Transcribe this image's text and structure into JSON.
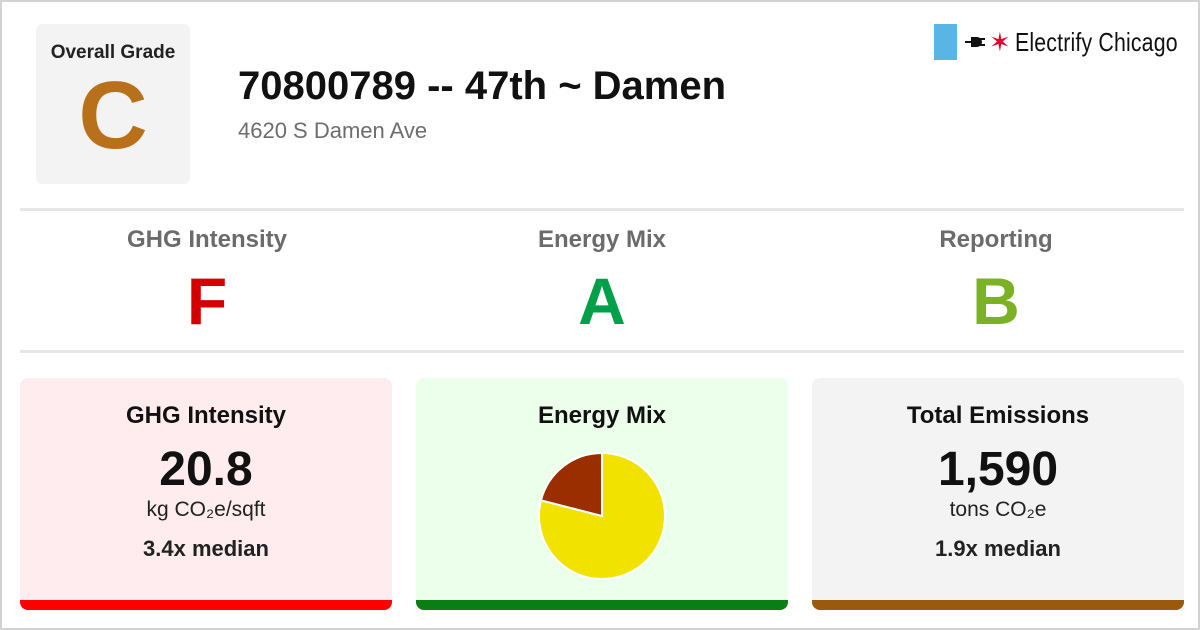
{
  "overall": {
    "label": "Overall Grade",
    "grade": "C",
    "color": "#b8711a"
  },
  "building": {
    "title": "70800789 -- 47th ~ Damen",
    "address": "4620 S Damen Ave"
  },
  "brand": {
    "name": "Electrify Chicago",
    "flag_color": "#58b5e4",
    "star_color": "#e4002b",
    "icons": [
      "plug-icon",
      "star-icon"
    ]
  },
  "subgrades": [
    {
      "label": "GHG Intensity",
      "grade": "F",
      "color": "#d40000"
    },
    {
      "label": "Energy Mix",
      "grade": "A",
      "color": "#00a04a"
    },
    {
      "label": "Reporting",
      "grade": "B",
      "color": "#7bb224"
    }
  ],
  "cards": {
    "ghg": {
      "title": "GHG Intensity",
      "value": "20.8",
      "unit": "kg CO₂e/sqft",
      "median": "3.4x median",
      "bg": "#ffecee",
      "bar": "#ff0000"
    },
    "mix": {
      "title": "Energy Mix",
      "bg": "#ebffea",
      "bar": "#0a7e12"
    },
    "total": {
      "title": "Total Emissions",
      "value": "1,590",
      "unit": "tons CO₂e",
      "median": "1.9x median",
      "bg": "#f3f3f3",
      "bar": "#9a5a0e"
    }
  },
  "chart_data": {
    "type": "pie",
    "slices": [
      {
        "value": 0.79,
        "color": "#f2e200"
      },
      {
        "value": 0.21,
        "color": "#9a2e00"
      }
    ]
  }
}
